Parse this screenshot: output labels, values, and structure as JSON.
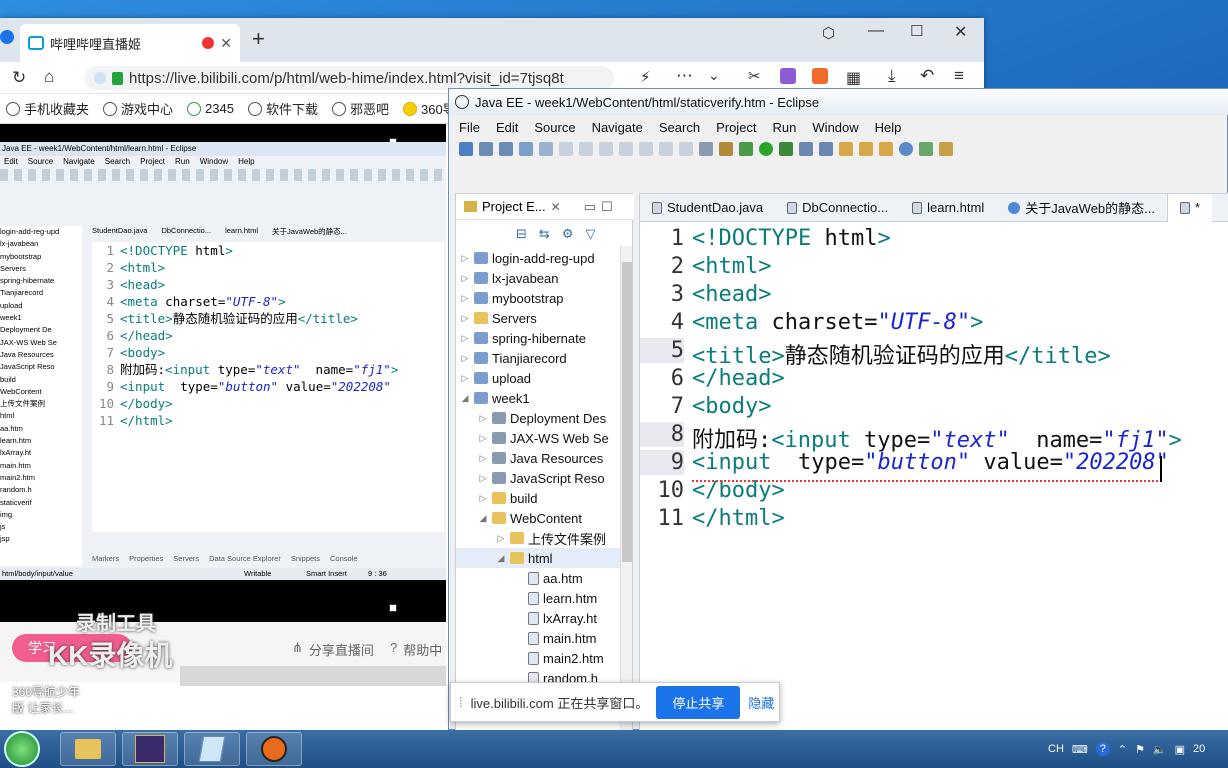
{
  "browser": {
    "tab_title": "哔哩哔哩直播姬",
    "url": "https://live.bilibili.com/p/html/web-hime/index.html?visit_id=7tjsq8t",
    "bookmarks": [
      "手机收藏夹",
      "游戏中心",
      "2345",
      "软件下载",
      "邪恶吧",
      "360导航"
    ]
  },
  "video_inner": {
    "title": "Java EE - week1/WebContent/html/learn.html - Eclipse",
    "menu": [
      "Edit",
      "Source",
      "Navigate",
      "Search",
      "Project",
      "Run",
      "Window",
      "Help"
    ],
    "tabs": [
      "StudentDao.java",
      "DbConnectio...",
      "learn.html",
      "关于JavaWeb的静态..."
    ],
    "tree": [
      "login-add-reg-upd",
      "lx-javabean",
      "mybootstrap",
      "Servers",
      "spring-hibernate",
      "Tianjiarecord",
      "upload",
      "week1",
      "Deployment De",
      "JAX-WS Web Se",
      "Java Resources",
      "JavaScript Reso",
      "build",
      "WebContent",
      "上传文件案例",
      "html",
      "aa.htm",
      "learn.htm",
      "lxArray.ht",
      "main.htm",
      "main2.htm",
      "random.h",
      "staticverif",
      "img",
      "js",
      "jsp"
    ],
    "code_lines": [
      "<!DOCTYPE html>",
      "<html>",
      "<head>",
      "<meta charset=\"UTF-8\">",
      "<title>静态随机验证码的应用</title>",
      "</head>",
      "<body>",
      "附加码:<input type=\"text\"  name=\"fj1\">",
      "<input  type=\"button\" value=\"202208\"",
      "</body>",
      "</html>"
    ],
    "bottom_tabs": [
      "Markers",
      "Properties",
      "Servers",
      "Data Source Explorer",
      "Snippets",
      "Console"
    ],
    "status_path": "html/body/input/value",
    "status_writable": "Writable",
    "status_insert": "Smart Insert",
    "status_pos": "9 : 36"
  },
  "live_info": {
    "share_label": "分享直播间",
    "help_label": "帮助中",
    "study_label": "学习"
  },
  "watermark": {
    "line1": "录制工具",
    "line2": "KK录像机"
  },
  "eclipse": {
    "title": "Java EE - week1/WebContent/html/staticverify.htm - Eclipse",
    "menu": [
      "File",
      "Edit",
      "Source",
      "Navigate",
      "Search",
      "Project",
      "Run",
      "Window",
      "Help"
    ],
    "project_explorer_title": "Project E...",
    "tree": [
      {
        "label": "login-add-reg-upd",
        "level": 0,
        "type": "project"
      },
      {
        "label": "lx-javabean",
        "level": 0,
        "type": "project"
      },
      {
        "label": "mybootstrap",
        "level": 0,
        "type": "project"
      },
      {
        "label": "Servers",
        "level": 0,
        "type": "folder"
      },
      {
        "label": "spring-hibernate",
        "level": 0,
        "type": "project"
      },
      {
        "label": "Tianjiarecord",
        "level": 0,
        "type": "project"
      },
      {
        "label": "upload",
        "level": 0,
        "type": "project"
      },
      {
        "label": "week1",
        "level": 0,
        "type": "project"
      },
      {
        "label": "Deployment Des",
        "level": 1,
        "type": "config"
      },
      {
        "label": "JAX-WS Web Se",
        "level": 1,
        "type": "config"
      },
      {
        "label": "Java Resources",
        "level": 1,
        "type": "config"
      },
      {
        "label": "JavaScript Reso",
        "level": 1,
        "type": "config"
      },
      {
        "label": "build",
        "level": 1,
        "type": "folder"
      },
      {
        "label": "WebContent",
        "level": 1,
        "type": "folder"
      },
      {
        "label": "上传文件案例",
        "level": 2,
        "type": "folder"
      },
      {
        "label": "html",
        "level": 2,
        "type": "folder"
      },
      {
        "label": "aa.htm",
        "level": 3,
        "type": "file"
      },
      {
        "label": "learn.htm",
        "level": 3,
        "type": "file"
      },
      {
        "label": "lxArray.ht",
        "level": 3,
        "type": "file"
      },
      {
        "label": "main.htm",
        "level": 3,
        "type": "file"
      },
      {
        "label": "main2.htm",
        "level": 3,
        "type": "file"
      },
      {
        "label": "random.h",
        "level": 3,
        "type": "file"
      }
    ],
    "editor_tabs": [
      "StudentDao.java",
      "DbConnectio...",
      "learn.html",
      "关于JavaWeb的静态...",
      "*"
    ],
    "line_numbers": [
      "1",
      "2",
      "3",
      "4",
      "5",
      "6",
      "7",
      "8",
      "9",
      "10",
      "11"
    ]
  },
  "share_bar": {
    "text": "live.bilibili.com 正在共享窗口。",
    "stop_label": "停止共享",
    "hide_label": "隐藏"
  },
  "desktop_text": {
    "line1": "360导航少年",
    "line2": "版 让家长..."
  },
  "tray": {
    "lang": "CH",
    "clock": "20"
  }
}
